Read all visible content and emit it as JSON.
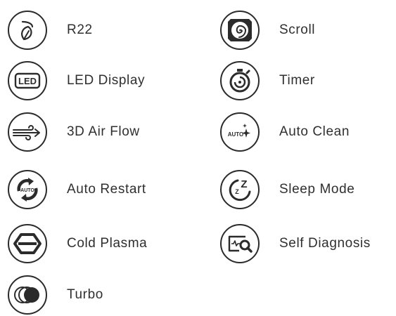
{
  "features": {
    "r22": {
      "label": "R22",
      "icon": "leaf-icon"
    },
    "led_display": {
      "label": "LED Display",
      "icon": "led-icon",
      "icon_text": "LED"
    },
    "air_flow": {
      "label": "3D Air Flow",
      "icon": "wind-icon"
    },
    "auto_restart": {
      "label": "Auto Restart",
      "icon": "auto-restart-icon",
      "icon_text": "AUTO"
    },
    "cold_plasma": {
      "label": "Cold Plasma",
      "icon": "hexagon-icon"
    },
    "turbo": {
      "label": "Turbo",
      "icon": "turbo-icon"
    },
    "scroll": {
      "label": "Scroll",
      "icon": "scroll-icon"
    },
    "timer": {
      "label": "Timer",
      "icon": "stopwatch-icon"
    },
    "auto_clean": {
      "label": "Auto Clean",
      "icon": "auto-clean-icon",
      "icon_text": "AUTO"
    },
    "sleep_mode": {
      "label": "Sleep Mode",
      "icon": "sleep-icon",
      "icon_text": "Z"
    },
    "self_diagnosis": {
      "label": "Self Diagnosis",
      "icon": "diagnosis-icon"
    }
  },
  "colors": {
    "icon_stroke": "#2b2b2b",
    "text": "#2f2f2f",
    "background": "#ffffff"
  }
}
